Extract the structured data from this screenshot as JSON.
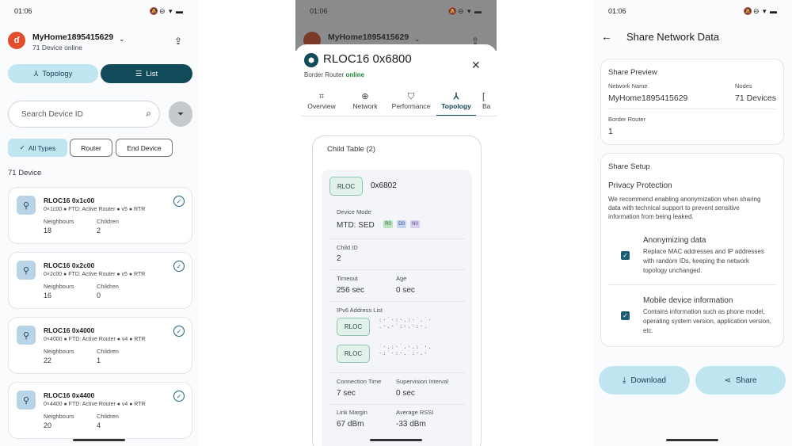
{
  "status": {
    "time": "01:06",
    "icons": "🔕⊖ ▾ ▬"
  },
  "s1": {
    "network_name": "MyHome1895415629",
    "device_online": "71 Device online",
    "tab_topology": "Topology",
    "tab_list": "List",
    "search_placeholder": "Search Device ID",
    "filter_all": "All Types",
    "filter_router": "Router",
    "filter_end": "End Device",
    "count": "71 Device",
    "neighbours_label": "Neighbours",
    "children_label": "Children",
    "devices": [
      {
        "title": "RLOC16 0x1c00",
        "sub": "0×1c00 ● FTD: Active Router ● v5 ● RTR",
        "neighbours": "18",
        "children": "2"
      },
      {
        "title": "RLOC16 0x2c00",
        "sub": "0×2c00 ● FTD: Active Router ● v5 ● RTR",
        "neighbours": "16",
        "children": "0"
      },
      {
        "title": "RLOC16 0x4000",
        "sub": "0×4000 ● FTD: Active Router ● v4 ● RTR",
        "neighbours": "22",
        "children": "1"
      },
      {
        "title": "RLOC16 0x4400",
        "sub": "0×4400 ● FTD: Active Router ● v4 ● RTR",
        "neighbours": "20",
        "children": "4"
      }
    ]
  },
  "s2": {
    "bg_title": "MyHome1895415629",
    "title": "RLOC16 0x6800",
    "role": "Border Router",
    "online": "online",
    "tabs": [
      "Overview",
      "Network",
      "Performance",
      "Topology",
      "Ba"
    ],
    "child_table": "Child Table (2)",
    "rloc_tag": "RLOC",
    "child_rloc": "0x6802",
    "device_mode_label": "Device Mode",
    "device_mode": "MTD: SED",
    "mode_flags": [
      "R0",
      "D0",
      "N0"
    ],
    "child_id_label": "Child ID",
    "child_id": "2",
    "timeout_label": "Timeout",
    "timeout": "256 sec",
    "age_label": "Age",
    "age": "0 sec",
    "ipv6_label": "IPv6 Address List",
    "conn_time_label": "Connection Time",
    "conn_time": "7 sec",
    "sup_label": "Supervision Interval",
    "sup": "0 sec",
    "link_margin_label": "Link Margin",
    "link_margin": "67 dBm",
    "rssi_label": "Average RSSI",
    "rssi": "-33 dBm"
  },
  "s3": {
    "title": "Share Network Data",
    "preview_title": "Share Preview",
    "net_name_label": "Network Name",
    "net_name": "MyHome1895415629",
    "nodes_label": "Nodes",
    "nodes": "71 Devices",
    "br_label": "Border Router",
    "br": "1",
    "setup_title": "Share Setup",
    "privacy_title": "Privacy Protection",
    "privacy_text": "We recommend enabling anonymization when sharing data with technical support to prevent sensitive information from being leaked.",
    "anon_title": "Anonymizing data",
    "anon_text": "Replace MAC addresses and IP addresses with random IDs, keeping the network topology unchanged.",
    "mobile_title": "Mobile device information",
    "mobile_text": "Contains information such as phone model, operating system version, application version, etc.",
    "download": "Download",
    "share": "Share"
  }
}
